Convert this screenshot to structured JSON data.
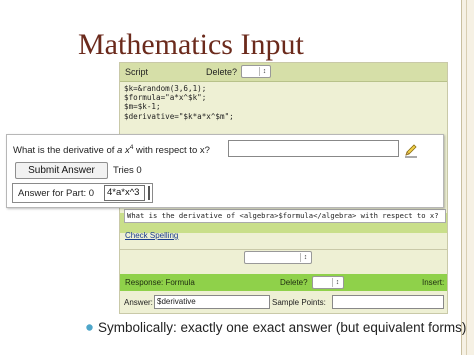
{
  "slide": {
    "title": "Mathematics Input",
    "bullet": "Symbolically: exactly one exact answer (but equivalent forms)"
  },
  "editor": {
    "script_label": "Script",
    "delete_label": "Delete?",
    "code": "$k=&random(3,6,1);\n$formula=\"a*x^$k\";\n$m=$k-1;\n$derivative=\"$k*a*x^$m\";",
    "problem_text": "What is the derivative of <algebra>$formula</algebra> with respect to x?",
    "check_spelling": "Check Spelling",
    "response": {
      "label": "Response: Formula",
      "delete_label": "Delete?",
      "insert_label": "Insert:",
      "answer_label": "Answer:",
      "answer_value": "$derivative",
      "sample_points_label": "Sample Points:"
    }
  },
  "preview": {
    "question_prefix": "What is the derivative of ",
    "question_var_a": "a",
    "question_var_x": "x",
    "question_exponent": "4",
    "question_suffix": " with respect to x?",
    "submit_label": "Submit Answer",
    "tries": "Tries 0",
    "part_label": "Answer for Part: 0",
    "part_answer": "4*a*x^3"
  },
  "colors": {
    "title": "#6b2a1c",
    "script_bar": "#d6dfa8",
    "response_bar": "#8fd14a",
    "bullet": "#4ea6c9"
  }
}
